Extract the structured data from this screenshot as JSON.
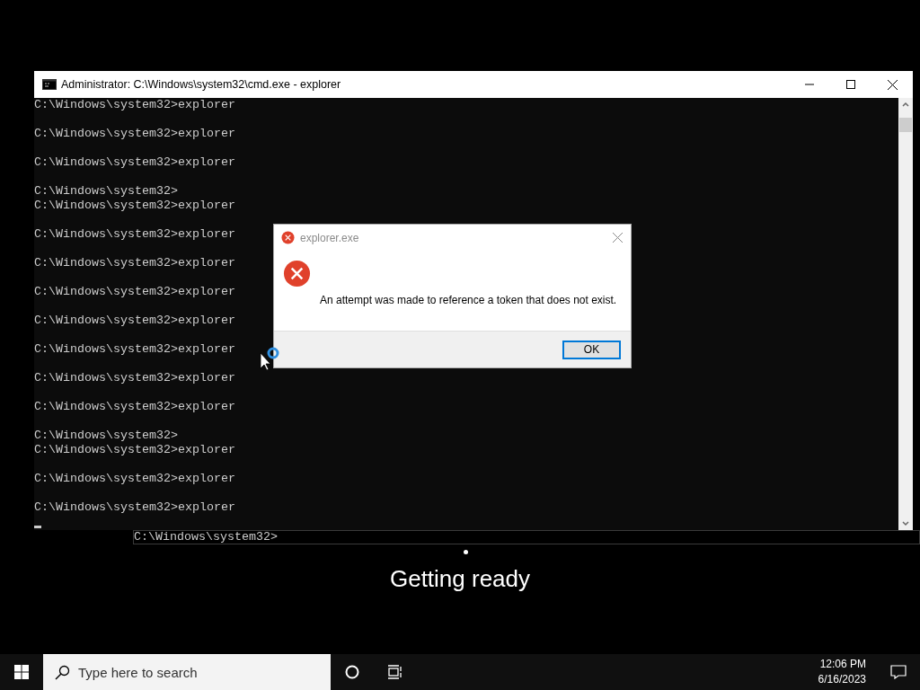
{
  "cmd_window": {
    "title": "Administrator: C:\\Windows\\system32\\cmd.exe - explorer",
    "cursor": true,
    "lines": [
      {
        "text": "C:\\Windows\\system32>explorer",
        "blank_after": true
      },
      {
        "text": "C:\\Windows\\system32>explorer",
        "blank_after": true
      },
      {
        "text": "C:\\Windows\\system32>explorer",
        "blank_after": true
      },
      {
        "text": "C:\\Windows\\system32>",
        "blank_after": false
      },
      {
        "text": "C:\\Windows\\system32>explorer",
        "blank_after": true
      },
      {
        "text": "C:\\Windows\\system32>explorer",
        "blank_after": true
      },
      {
        "text": "C:\\Windows\\system32>explorer",
        "blank_after": true
      },
      {
        "text": "C:\\Windows\\system32>explorer",
        "blank_after": true
      },
      {
        "text": "C:\\Windows\\system32>explorer",
        "blank_after": true
      },
      {
        "text": "C:\\Windows\\system32>explorer",
        "blank_after": true
      },
      {
        "text": "C:\\Windows\\system32>explorer",
        "blank_after": true
      },
      {
        "text": "C:\\Windows\\system32>explorer",
        "blank_after": true
      },
      {
        "text": "C:\\Windows\\system32>",
        "blank_after": false
      },
      {
        "text": "C:\\Windows\\system32>explorer",
        "blank_after": true
      },
      {
        "text": "C:\\Windows\\system32>explorer",
        "blank_after": true
      },
      {
        "text": "C:\\Windows\\system32>explorer",
        "blank_after": false
      }
    ]
  },
  "prompt_line": "C:\\Windows\\system32>",
  "dialog": {
    "title": "explorer.exe",
    "message": "An attempt was made to reference a token that does not exist.",
    "button": "OK"
  },
  "status": {
    "text": "Getting ready"
  },
  "taskbar": {
    "search": {
      "placeholder": "Type here to search"
    },
    "time": "12:06 PM",
    "date": "6/16/2023"
  }
}
